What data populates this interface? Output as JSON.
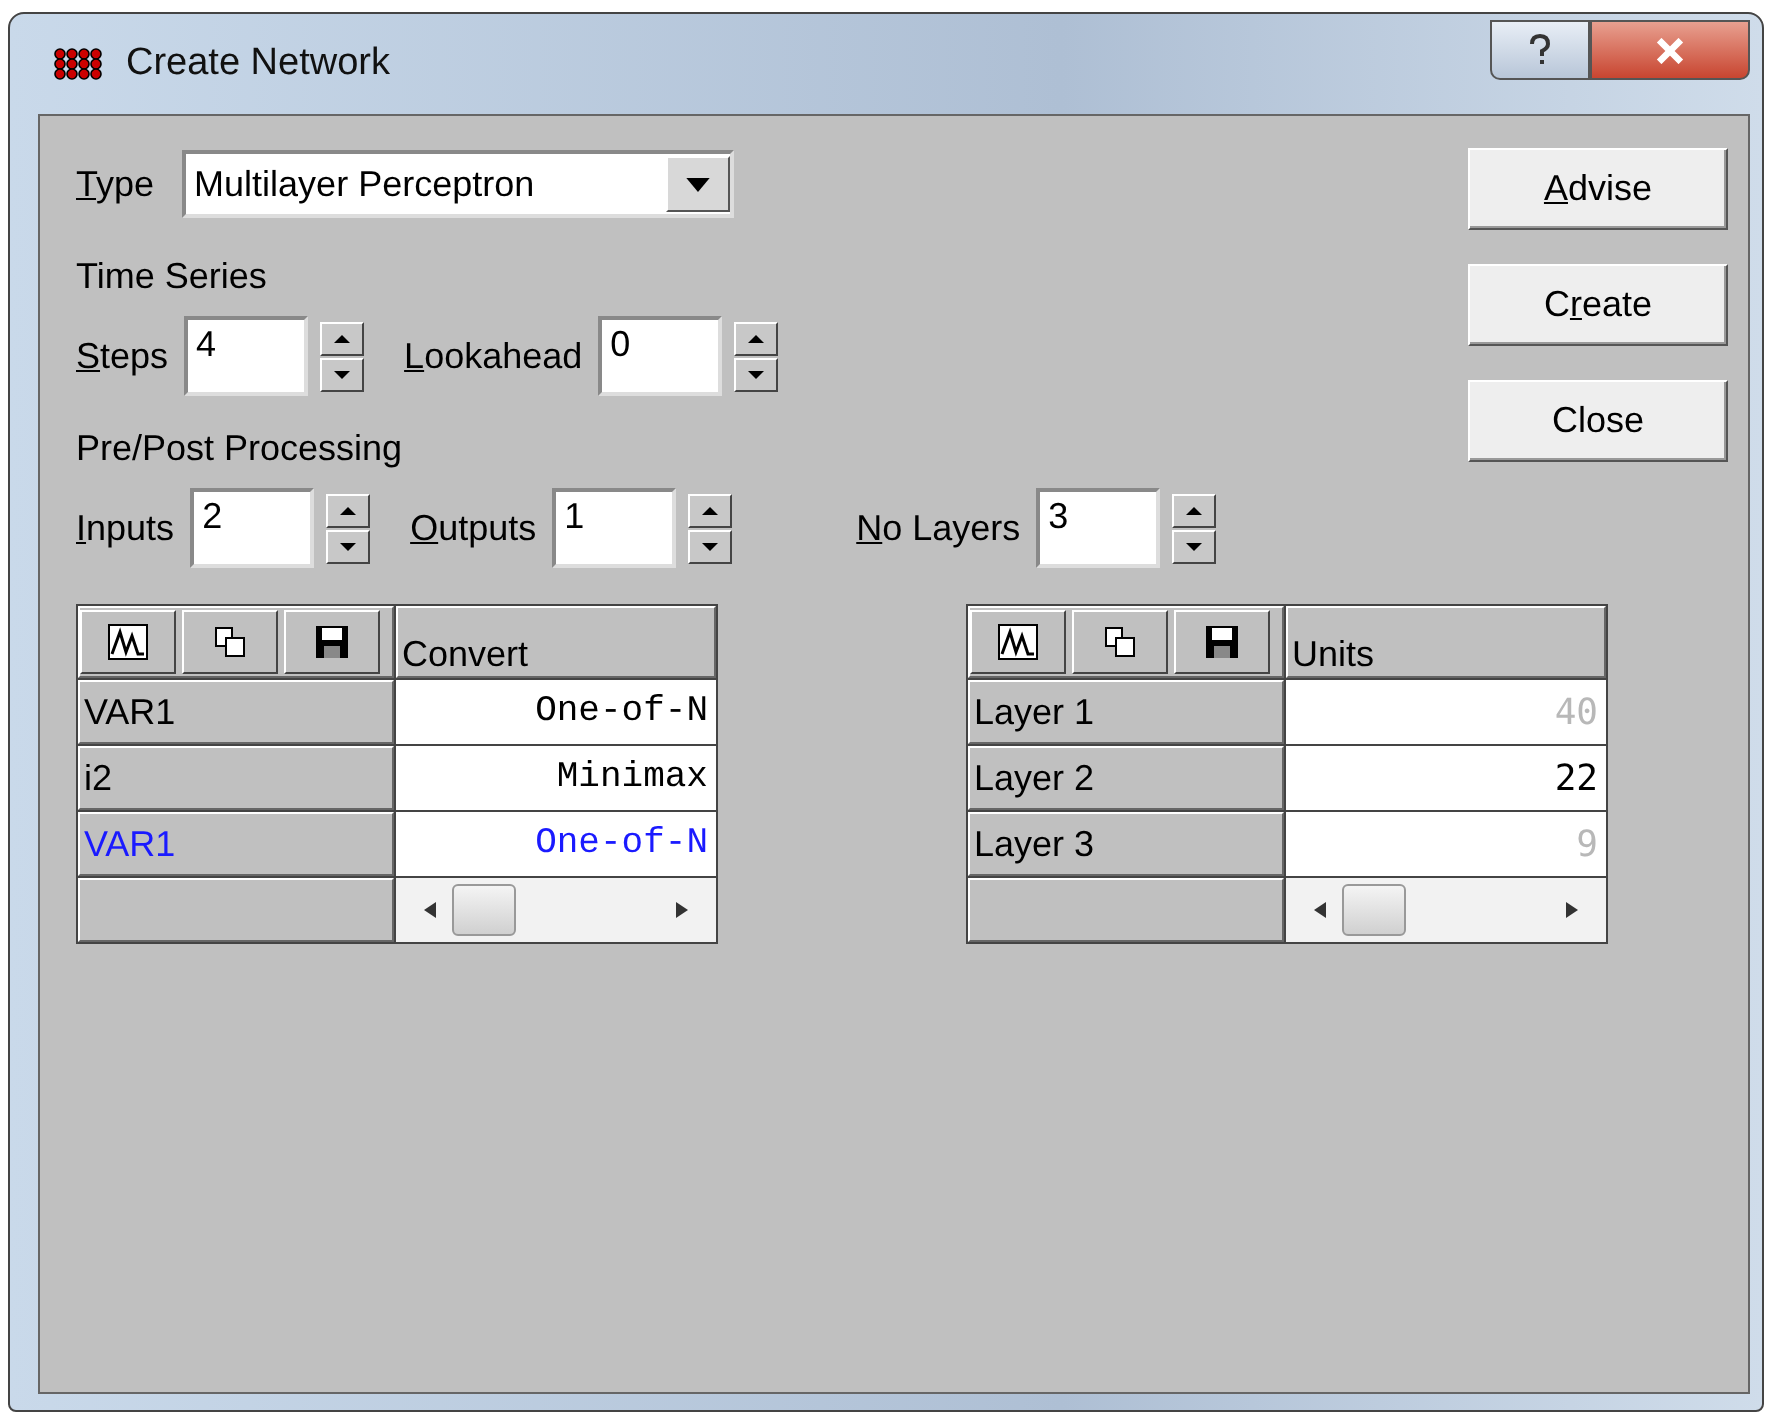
{
  "window": {
    "title": "Create Network"
  },
  "type": {
    "access_key": "T",
    "label_rest": "ype",
    "value": "Multilayer Perceptron"
  },
  "time_series": {
    "heading": "Time Series",
    "spinners": [
      {
        "access_key": "S",
        "label_rest": "teps",
        "value": "4"
      },
      {
        "access_key": "L",
        "label_rest": "ookahead",
        "value": "0"
      }
    ]
  },
  "processing": {
    "heading": "Pre/Post Processing",
    "spinners": [
      {
        "access_key": "I",
        "label_rest": "nputs",
        "value": "2"
      },
      {
        "access_key": "O",
        "label_rest": "utputs",
        "value": "1"
      },
      {
        "access_key": "N",
        "label_rest": "o Layers",
        "value": "3"
      }
    ]
  },
  "buttons": [
    {
      "access_key": "A",
      "label_rest": "dvise"
    },
    {
      "label_start": "C",
      "access_key": "r",
      "label_rest": "eate"
    },
    {
      "label_start": "Close"
    }
  ],
  "conversion_table": {
    "column": "Convert",
    "rows": [
      {
        "name": "VAR1",
        "value": "One-of-N",
        "selected": false
      },
      {
        "name": "i2",
        "value": "Minimax",
        "selected": false
      },
      {
        "name": "VAR1",
        "value": "One-of-N",
        "selected": true
      }
    ]
  },
  "layers_table": {
    "column": "Units",
    "rows": [
      {
        "name": "Layer 1",
        "value": "40",
        "dimmed": true
      },
      {
        "name": "Layer 2",
        "value": "22",
        "dimmed": false
      },
      {
        "name": "Layer 3",
        "value": "9",
        "dimmed": true
      }
    ]
  }
}
